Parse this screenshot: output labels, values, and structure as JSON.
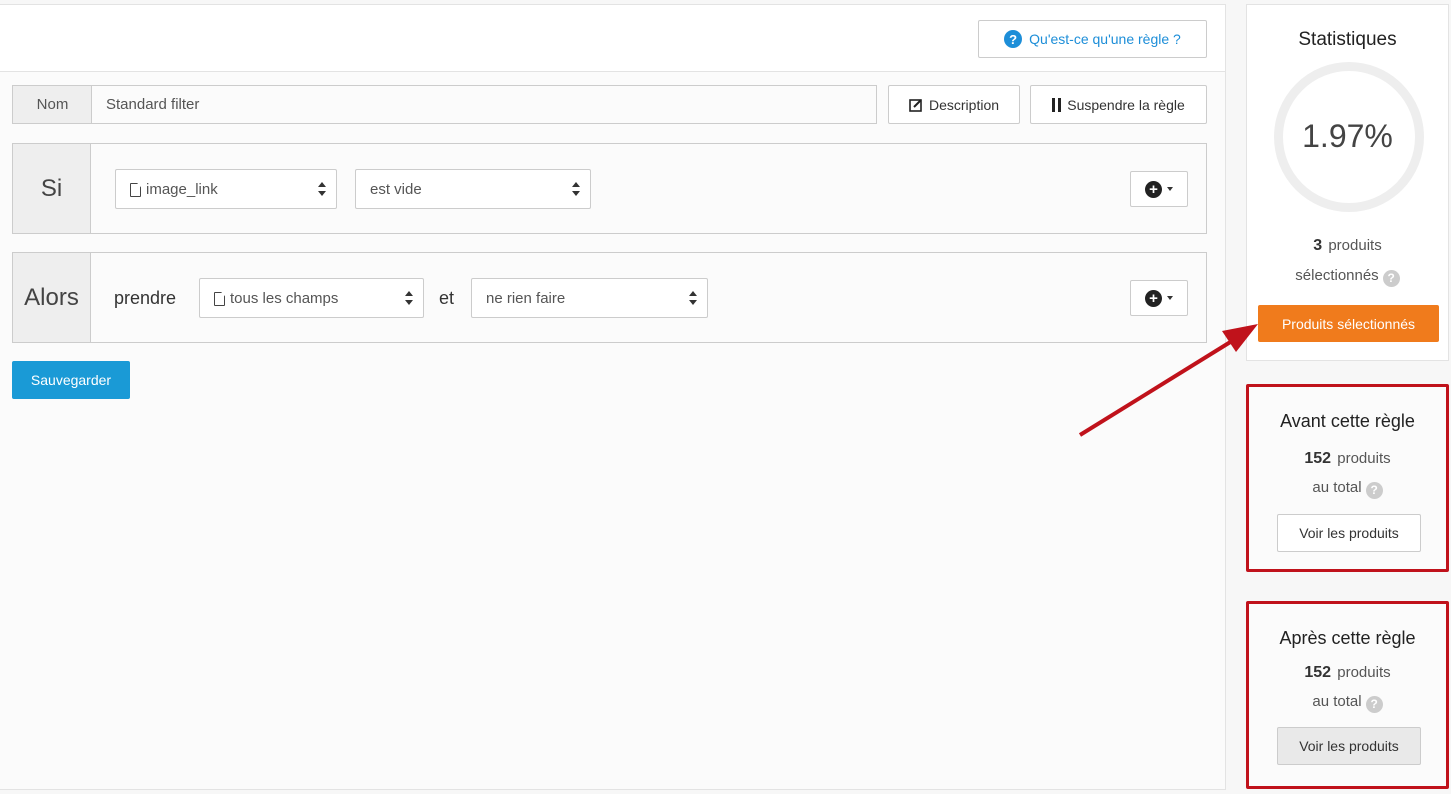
{
  "header": {
    "help_label": "Qu'est-ce qu'une règle ?"
  },
  "rule": {
    "name_label": "Nom",
    "name_value": "Standard filter",
    "description_label": "Description",
    "suspend_label": "Suspendre la règle"
  },
  "si": {
    "label": "Si",
    "field": "image_link",
    "operator": "est vide"
  },
  "alors": {
    "label": "Alors",
    "prefix": "prendre",
    "field": "tous les champs",
    "connector": "et",
    "action": "ne rien faire"
  },
  "save_label": "Sauvegarder",
  "stats": {
    "title": "Statistiques",
    "percent": "1.97%",
    "count": "3",
    "count_unit": "produits",
    "count_suffix": "sélectionnés",
    "button": "Produits sélectionnés"
  },
  "avant": {
    "title": "Avant cette règle",
    "count": "152",
    "count_unit": "produits",
    "count_suffix": "au total",
    "button": "Voir les produits"
  },
  "apres": {
    "title": "Après cette règle",
    "count": "152",
    "count_unit": "produits",
    "count_suffix": "au total",
    "button": "Voir les produits"
  },
  "colors": {
    "accent_blue": "#1a9ad6",
    "orange": "#f07b1c",
    "highlight_red": "#c0121b"
  }
}
